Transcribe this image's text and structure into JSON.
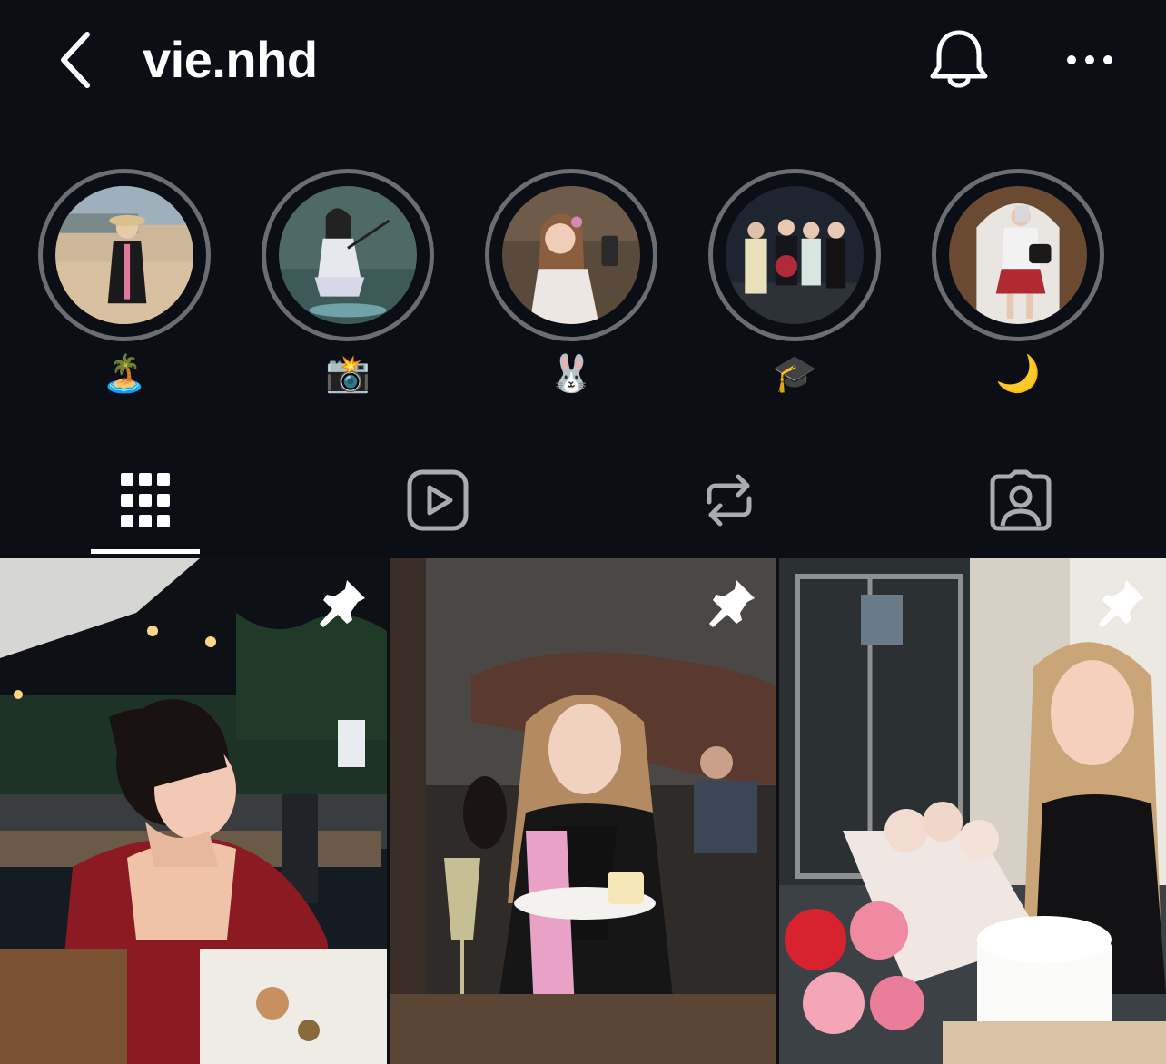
{
  "header": {
    "username": "vie.nhd",
    "back_icon": "chevron-left-icon",
    "bell_icon": "bell-icon",
    "more_icon": "more-horizontal-icon"
  },
  "highlights": [
    {
      "label": "🏝️"
    },
    {
      "label": "📸"
    },
    {
      "label": "🐰"
    },
    {
      "label": "🎓"
    },
    {
      "label": "🌙"
    }
  ],
  "tabs": [
    {
      "name": "posts-grid",
      "icon": "grid-icon",
      "active": true
    },
    {
      "name": "reels",
      "icon": "reels-play-icon",
      "active": false
    },
    {
      "name": "reposts",
      "icon": "repost-icon",
      "active": false
    },
    {
      "name": "tagged",
      "icon": "tagged-person-icon",
      "active": false
    }
  ],
  "posts": [
    {
      "pinned": true,
      "icon": "pin-icon"
    },
    {
      "pinned": true,
      "icon": "pin-icon"
    },
    {
      "pinned": true,
      "icon": "pin-icon"
    }
  ],
  "colors": {
    "background": "#0b0e14",
    "text": "#ffffff",
    "ring": "#6b6d72",
    "icon_muted": "#a9abb0"
  }
}
